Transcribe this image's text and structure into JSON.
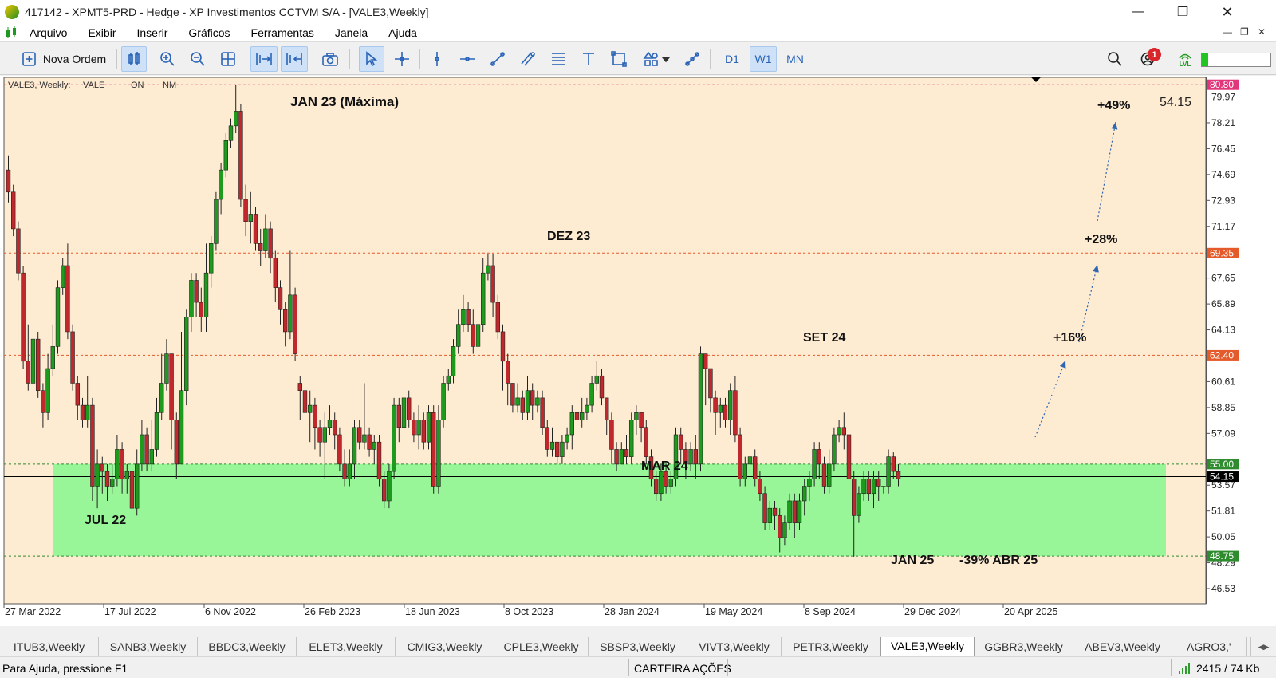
{
  "window": {
    "title": "417142 - XPMT5-PRD - Hedge - XP Investimentos CCTVM S/A - [VALE3,Weekly]"
  },
  "menu": [
    "Arquivo",
    "Exibir",
    "Inserir",
    "Gráficos",
    "Ferramentas",
    "Janela",
    "Ajuda"
  ],
  "toolbar": {
    "new_order": "Nova Ordem",
    "timeframes": [
      "D1",
      "W1",
      "MN"
    ],
    "active_timeframe": "W1",
    "notifications": "1",
    "lvl": "LVL"
  },
  "chart": {
    "info": {
      "symbol": "VALE3, Weekly:",
      "name": "VALE",
      "label1": "ON",
      "label2": "NM"
    },
    "price_readout": "54.15",
    "colors": {
      "bg": "#fdebd2",
      "bull": "#1e9a1e",
      "bear": "#c0282d",
      "zone": "#98f598",
      "dash": "#e25050"
    },
    "y_axis": {
      "min": 45.5,
      "max": 81.3,
      "ticks": [
        "79.97",
        "78.21",
        "76.45",
        "74.69",
        "72.93",
        "71.17",
        "69.35",
        "67.65",
        "65.89",
        "64.13",
        "62.40",
        "60.61",
        "58.85",
        "57.09",
        "55.00",
        "54.15",
        "53.57",
        "51.81",
        "50.05",
        "48.75",
        "48.29",
        "46.53",
        "80.80"
      ]
    },
    "tick_values": [
      79.97,
      78.21,
      76.45,
      74.69,
      72.93,
      71.17,
      67.65,
      65.89,
      64.13,
      60.61,
      58.85,
      57.09,
      53.57,
      51.81,
      50.05,
      48.29,
      46.53
    ],
    "levels": [
      {
        "price": 80.8,
        "label": "80.80",
        "color": "#e2367a"
      },
      {
        "price": 69.35,
        "label": "69.35",
        "color": "#e55a2b"
      },
      {
        "price": 62.4,
        "label": "62.40",
        "color": "#e55a2b"
      },
      {
        "price": 55.0,
        "label": "55.00",
        "color": "#2e8b2e"
      },
      {
        "price": 54.15,
        "label": "54.15",
        "color": "#000000"
      },
      {
        "price": 48.75,
        "label": "48.75",
        "color": "#2e8b2e"
      }
    ],
    "x_labels": [
      "27 Mar 2022",
      "17 Jul 2022",
      "6 Nov 2022",
      "26 Feb 2023",
      "18 Jun 2023",
      "8 Oct 2023",
      "28 Jan 2024",
      "19 May 2024",
      "8 Sep 2024",
      "29 Dec 2024",
      "20 Apr 2025"
    ],
    "annotations": [
      "JAN 23 (Máxima)",
      "DEZ 23",
      "SET 24",
      "MAR 24",
      "JUL 22",
      "JAN 25",
      "-39% ABR 25",
      "+16%",
      "+28%",
      "+49%"
    ],
    "candles": [
      [
        75.0,
        73.5,
        76.0,
        72.8
      ],
      [
        73.5,
        71.0,
        74.0,
        70.5
      ],
      [
        71.0,
        68.0,
        71.5,
        67.5
      ],
      [
        68.0,
        62.0,
        68.5,
        61.5
      ],
      [
        62.0,
        60.5,
        64.5,
        60.0
      ],
      [
        60.5,
        63.5,
        64.0,
        60.0
      ],
      [
        63.5,
        60.0,
        64.0,
        59.5
      ],
      [
        60.0,
        58.5,
        60.5,
        57.5
      ],
      [
        58.5,
        61.5,
        62.5,
        58.0
      ],
      [
        61.5,
        63.0,
        64.5,
        61.0
      ],
      [
        63.0,
        67.0,
        67.5,
        62.5
      ],
      [
        67.0,
        68.5,
        69.0,
        66.5
      ],
      [
        68.5,
        64.0,
        70.0,
        63.5
      ],
      [
        64.0,
        60.5,
        64.5,
        60.0
      ],
      [
        60.5,
        59.0,
        61.0,
        58.0
      ],
      [
        59.0,
        58.0,
        59.5,
        57.5
      ],
      [
        58.0,
        59.0,
        61.0,
        57.5
      ],
      [
        59.0,
        53.5,
        59.5,
        52.5
      ],
      [
        53.5,
        55.0,
        56.0,
        52.0
      ],
      [
        55.0,
        54.5,
        55.5,
        53.0
      ],
      [
        54.5,
        53.5,
        55.0,
        52.5
      ],
      [
        53.5,
        54.0,
        55.0,
        53.0
      ],
      [
        54.0,
        56.0,
        57.0,
        53.5
      ],
      [
        56.0,
        54.0,
        56.5,
        53.0
      ],
      [
        54.0,
        54.5,
        55.0,
        53.0
      ],
      [
        54.5,
        52.0,
        55.0,
        51.0
      ],
      [
        52.0,
        55.0,
        56.0,
        51.5
      ],
      [
        55.0,
        57.0,
        58.0,
        54.5
      ],
      [
        57.0,
        55.0,
        57.5,
        54.5
      ],
      [
        55.0,
        56.0,
        58.0,
        54.5
      ],
      [
        56.0,
        58.5,
        59.5,
        55.5
      ],
      [
        58.5,
        60.5,
        62.5,
        58.0
      ],
      [
        60.5,
        62.5,
        63.5,
        60.0
      ],
      [
        62.5,
        58.0,
        62.5,
        56.0
      ],
      [
        58.0,
        55.0,
        58.5,
        54.0
      ],
      [
        55.0,
        60.0,
        64.0,
        55.0
      ],
      [
        60.0,
        65.0,
        65.5,
        59.0
      ],
      [
        65.0,
        67.5,
        68.0,
        64.0
      ],
      [
        67.5,
        66.0,
        68.0,
        65.0
      ],
      [
        66.0,
        65.0,
        67.0,
        64.0
      ],
      [
        65.0,
        68.0,
        70.0,
        64.0
      ],
      [
        68.0,
        70.0,
        70.5,
        67.0
      ],
      [
        70.0,
        73.0,
        73.5,
        69.5
      ],
      [
        73.0,
        75.0,
        75.5,
        72.0
      ],
      [
        75.0,
        77.0,
        77.5,
        74.5
      ],
      [
        77.0,
        78.0,
        78.5,
        76.5
      ],
      [
        78.0,
        79.0,
        80.8,
        77.5
      ],
      [
        79.0,
        73.0,
        79.5,
        72.5
      ],
      [
        73.0,
        71.5,
        74.0,
        70.5
      ],
      [
        71.5,
        72.0,
        73.5,
        70.0
      ],
      [
        72.0,
        70.0,
        72.5,
        69.5
      ],
      [
        70.0,
        69.5,
        71.0,
        68.5
      ],
      [
        69.5,
        71.0,
        72.0,
        69.0
      ],
      [
        71.0,
        69.0,
        71.5,
        68.0
      ],
      [
        69.0,
        67.0,
        69.5,
        66.0
      ],
      [
        67.0,
        65.5,
        67.5,
        64.5
      ],
      [
        65.5,
        64.0,
        66.0,
        63.0
      ],
      [
        64.0,
        66.5,
        69.5,
        63.5
      ],
      [
        66.5,
        62.5,
        67.0,
        62.0
      ],
      [
        60.5,
        60.0,
        61.0,
        58.0
      ],
      [
        60.0,
        58.5,
        60.0,
        57.0
      ],
      [
        58.5,
        59.0,
        60.0,
        56.5
      ],
      [
        59.0,
        57.5,
        59.5,
        56.0
      ],
      [
        57.5,
        56.5,
        58.0,
        55.5
      ],
      [
        56.5,
        57.5,
        58.5,
        54.0
      ],
      [
        57.5,
        58.0,
        59.0,
        57.0
      ],
      [
        58.0,
        57.0,
        58.5,
        56.0
      ],
      [
        57.0,
        55.0,
        57.5,
        54.5
      ],
      [
        55.0,
        54.0,
        56.0,
        53.5
      ],
      [
        54.0,
        55.0,
        56.0,
        53.5
      ],
      [
        55.0,
        57.5,
        58.0,
        54.0
      ],
      [
        57.5,
        56.5,
        58.0,
        56.0
      ],
      [
        56.5,
        57.0,
        60.5,
        56.0
      ],
      [
        57.0,
        56.0,
        57.5,
        55.5
      ],
      [
        56.0,
        56.5,
        57.0,
        55.0
      ],
      [
        56.5,
        54.0,
        57.0,
        53.5
      ],
      [
        54.0,
        52.5,
        54.5,
        52.0
      ],
      [
        52.5,
        54.5,
        55.0,
        52.0
      ],
      [
        54.5,
        59.0,
        59.5,
        54.0
      ],
      [
        59.0,
        57.5,
        59.5,
        56.5
      ],
      [
        57.5,
        59.5,
        60.0,
        57.0
      ],
      [
        59.5,
        58.0,
        60.0,
        57.5
      ],
      [
        58.0,
        57.0,
        58.5,
        56.5
      ],
      [
        57.0,
        58.0,
        59.0,
        56.0
      ],
      [
        58.0,
        56.5,
        58.5,
        56.0
      ],
      [
        56.5,
        58.5,
        59.0,
        56.0
      ],
      [
        58.5,
        53.5,
        59.0,
        53.0
      ],
      [
        53.5,
        58.0,
        59.0,
        53.0
      ],
      [
        58.0,
        60.5,
        61.0,
        57.5
      ],
      [
        60.5,
        61.0,
        61.5,
        60.0
      ],
      [
        61.0,
        63.0,
        63.5,
        60.5
      ],
      [
        63.0,
        64.5,
        65.5,
        62.5
      ],
      [
        64.5,
        65.5,
        66.5,
        64.0
      ],
      [
        65.5,
        64.5,
        66.0,
        64.0
      ],
      [
        64.5,
        63.0,
        65.5,
        62.5
      ],
      [
        63.0,
        64.5,
        65.5,
        62.0
      ],
      [
        64.5,
        68.0,
        69.0,
        64.0
      ],
      [
        68.0,
        68.5,
        69.3,
        67.5
      ],
      [
        68.5,
        66.0,
        69.3,
        65.0
      ],
      [
        66.0,
        64.0,
        66.5,
        63.5
      ],
      [
        64.0,
        62.0,
        64.5,
        60.0
      ],
      [
        62.0,
        60.5,
        62.5,
        59.0
      ],
      [
        60.5,
        59.0,
        60.5,
        58.5
      ],
      [
        59.0,
        59.5,
        60.5,
        58.5
      ],
      [
        59.5,
        58.5,
        60.0,
        58.0
      ],
      [
        58.5,
        60.0,
        61.0,
        58.0
      ],
      [
        60.0,
        59.0,
        60.5,
        58.0
      ],
      [
        59.0,
        59.5,
        60.0,
        58.5
      ],
      [
        59.5,
        57.5,
        60.0,
        57.0
      ],
      [
        57.5,
        56.0,
        58.0,
        55.5
      ],
      [
        56.0,
        56.5,
        57.5,
        55.5
      ],
      [
        56.5,
        55.5,
        56.5,
        55.0
      ],
      [
        55.5,
        56.5,
        57.0,
        55.0
      ],
      [
        56.5,
        57.0,
        57.5,
        56.0
      ],
      [
        57.0,
        58.5,
        59.0,
        56.0
      ],
      [
        58.5,
        58.0,
        59.0,
        57.5
      ],
      [
        58.0,
        58.5,
        59.5,
        57.5
      ],
      [
        58.5,
        59.0,
        59.5,
        58.0
      ],
      [
        59.0,
        60.5,
        61.0,
        58.5
      ],
      [
        60.5,
        61.0,
        62.0,
        60.0
      ],
      [
        61.0,
        59.5,
        61.5,
        59.0
      ],
      [
        59.5,
        58.0,
        59.5,
        57.0
      ],
      [
        58.0,
        56.0,
        58.5,
        55.0
      ],
      [
        56.0,
        55.0,
        56.5,
        54.5
      ],
      [
        55.0,
        56.0,
        56.5,
        55.0
      ],
      [
        56.0,
        55.5,
        57.0,
        55.0
      ],
      [
        55.5,
        58.0,
        58.5,
        55.0
      ],
      [
        58.0,
        58.5,
        59.0,
        57.0
      ],
      [
        58.5,
        57.5,
        58.5,
        56.5
      ],
      [
        57.5,
        55.5,
        58.0,
        55.0
      ],
      [
        55.5,
        54.0,
        56.0,
        53.5
      ],
      [
        54.0,
        53.0,
        54.5,
        52.5
      ],
      [
        53.0,
        54.5,
        55.0,
        52.5
      ],
      [
        54.5,
        53.5,
        55.0,
        53.0
      ],
      [
        53.5,
        54.0,
        54.5,
        53.0
      ],
      [
        54.0,
        57.0,
        57.5,
        53.5
      ],
      [
        57.0,
        56.0,
        57.5,
        55.0
      ],
      [
        56.0,
        55.0,
        56.5,
        54.0
      ],
      [
        55.0,
        56.0,
        56.5,
        54.5
      ],
      [
        56.0,
        55.0,
        57.0,
        54.0
      ],
      [
        55.0,
        62.5,
        63.0,
        54.5
      ],
      [
        62.5,
        61.5,
        62.5,
        59.0
      ],
      [
        61.5,
        59.5,
        61.5,
        58.5
      ],
      [
        59.5,
        58.5,
        60.0,
        57.0
      ],
      [
        58.5,
        59.0,
        59.5,
        57.5
      ],
      [
        59.0,
        58.0,
        59.5,
        57.5
      ],
      [
        58.0,
        60.0,
        60.5,
        57.0
      ],
      [
        60.0,
        57.0,
        61.0,
        56.5
      ],
      [
        57.0,
        54.0,
        57.5,
        53.5
      ],
      [
        54.0,
        55.0,
        55.5,
        53.5
      ],
      [
        55.0,
        55.5,
        56.0,
        54.0
      ],
      [
        55.5,
        54.0,
        56.0,
        53.5
      ],
      [
        54.0,
        53.0,
        54.5,
        52.5
      ],
      [
        53.0,
        51.0,
        53.5,
        50.5
      ],
      [
        51.0,
        52.0,
        52.5,
        50.5
      ],
      [
        52.0,
        51.5,
        52.5,
        50.5
      ],
      [
        51.5,
        50.0,
        52.0,
        49.0
      ],
      [
        50.0,
        51.0,
        51.5,
        49.5
      ],
      [
        51.0,
        52.5,
        53.0,
        50.5
      ],
      [
        52.5,
        51.0,
        53.0,
        50.0
      ],
      [
        51.0,
        52.5,
        53.0,
        50.5
      ],
      [
        52.5,
        53.5,
        54.0,
        51.5
      ],
      [
        53.5,
        54.0,
        54.5,
        52.5
      ],
      [
        54.0,
        56.0,
        56.5,
        53.5
      ],
      [
        56.0,
        55.0,
        56.5,
        54.0
      ],
      [
        55.0,
        53.5,
        55.5,
        53.0
      ],
      [
        53.5,
        55.0,
        56.0,
        53.0
      ],
      [
        55.0,
        57.0,
        57.5,
        54.5
      ],
      [
        57.0,
        57.5,
        58.0,
        56.5
      ],
      [
        57.5,
        57.0,
        58.5,
        56.0
      ],
      [
        57.0,
        54.0,
        57.5,
        53.5
      ],
      [
        54.0,
        51.5,
        54.5,
        48.7
      ],
      [
        51.5,
        53.0,
        53.5,
        51.0
      ],
      [
        53.0,
        54.0,
        54.5,
        52.5
      ],
      [
        54.0,
        53.0,
        54.5,
        52.5
      ],
      [
        53.0,
        54.0,
        54.5,
        52.0
      ],
      [
        54.0,
        53.5,
        54.5,
        52.5
      ],
      [
        53.5,
        53.5,
        53.5,
        53.0
      ],
      [
        53.5,
        55.5,
        56.0,
        53.0
      ],
      [
        55.5,
        54.5,
        55.8,
        54.0
      ],
      [
        54.5,
        54.0,
        55.0,
        53.5
      ]
    ],
    "candle_highlights": [
      46,
      97,
      141,
      166
    ]
  },
  "tabs": [
    "ITUB3,Weekly",
    "SANB3,Weekly",
    "BBDC3,Weekly",
    "ELET3,Weekly",
    "CMIG3,Weekly",
    "CPLE3,Weekly",
    "SBSP3,Weekly",
    "VIVT3,Weekly",
    "PETR3,Weekly",
    "VALE3,Weekly",
    "GGBR3,Weekly",
    "ABEV3,Weekly",
    "AGRO3,'"
  ],
  "active_tab": "VALE3,Weekly",
  "status": {
    "help": "Para Ajuda, pressione F1",
    "profile": "CARTEIRA AÇÕES",
    "traffic": "2415 / 74 Kb"
  }
}
